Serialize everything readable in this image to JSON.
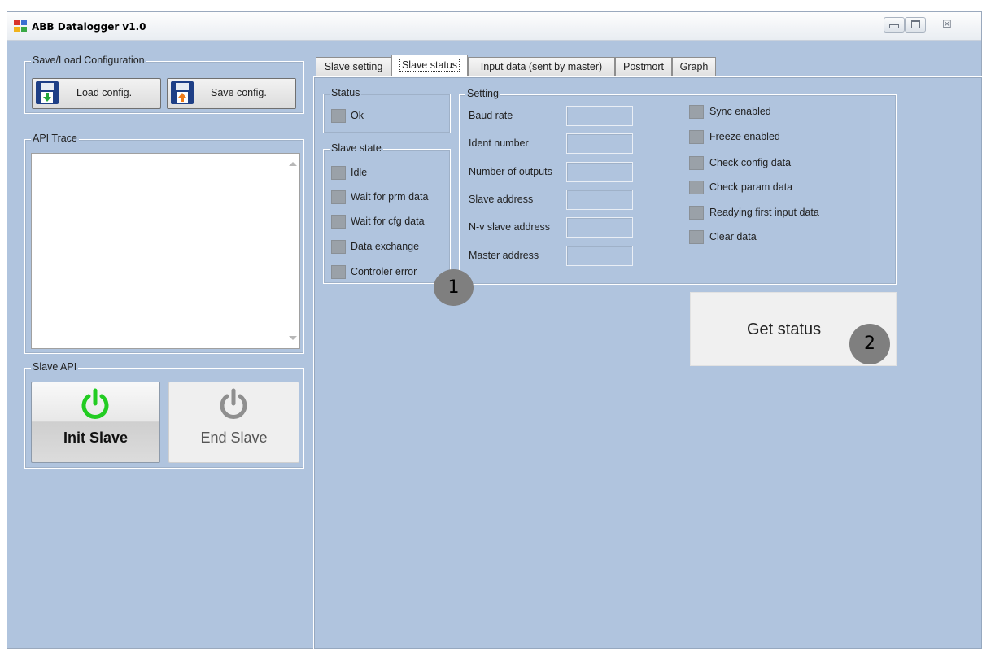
{
  "window": {
    "title": "ABB Datalogger v1.0",
    "controls": [
      "minimize",
      "maximize",
      "close"
    ],
    "close_glyph": "☒"
  },
  "left": {
    "config_group": {
      "label": "Save/Load Configuration",
      "load": "Load config.",
      "save": "Save config."
    },
    "trace_group": {
      "label": "API Trace"
    },
    "slave_api": {
      "label": "Slave API",
      "init": "Init Slave",
      "end": "End Slave"
    }
  },
  "tabs": [
    {
      "label": "Slave setting",
      "active": false
    },
    {
      "label": "Slave status",
      "active": true
    },
    {
      "label": "Input data (sent by master)",
      "active": false
    },
    {
      "label": "Postmort",
      "active": false
    },
    {
      "label": "Graph",
      "active": false
    }
  ],
  "status_group": {
    "label": "Status",
    "items": [
      "Ok"
    ]
  },
  "slave_state_group": {
    "label": "Slave state",
    "items": [
      "Idle",
      "Wait for prm data",
      "Wait for cfg data",
      "Data exchange",
      "Controler error"
    ]
  },
  "setting_group": {
    "label": "Setting",
    "fields": [
      {
        "label": "Baud rate",
        "value": ""
      },
      {
        "label": "Ident number",
        "value": ""
      },
      {
        "label": "Number of outputs",
        "value": ""
      },
      {
        "label": "Slave address",
        "value": ""
      },
      {
        "label": "N-v slave address",
        "value": ""
      },
      {
        "label": "Master address",
        "value": ""
      }
    ],
    "flags": [
      "Sync enabled",
      "Freeze enabled",
      "Check config data",
      "Check param data",
      "Readying first input data",
      "Clear data"
    ]
  },
  "get_status": "Get status",
  "markers": [
    "1",
    "2"
  ],
  "colors": {
    "panel": "#b0c4de",
    "init_power_icon": "#22cc22",
    "end_power_icon": "#8f8f8f",
    "marker": "#7f7f7f"
  }
}
